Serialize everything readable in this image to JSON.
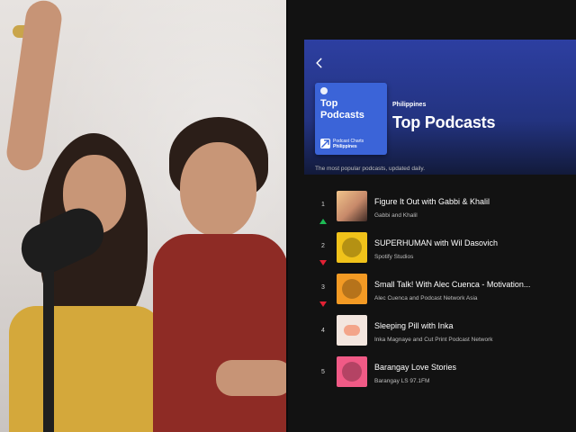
{
  "header": {
    "region": "Philippines",
    "title": "Top Podcasts",
    "cover": {
      "title_line1": "Top",
      "title_line2": "Podcasts",
      "subtitle_line1": "Podcast Charts",
      "subtitle_line2": "Philippines"
    }
  },
  "description": "The most popular podcasts, updated daily.",
  "list": [
    {
      "rank": "1",
      "title": "Figure It Out with Gabbi & Khalil",
      "author": "Gabbi and Khalil",
      "trend": "up"
    },
    {
      "rank": "2",
      "title": "SUPERHUMAN with Wil Dasovich",
      "author": "Spotify Studios",
      "trend": "down"
    },
    {
      "rank": "3",
      "title": "Small Talk! With Alec Cuenca - Motivation...",
      "author": "Alec Cuenca and Podcast Network Asia",
      "trend": "down"
    },
    {
      "rank": "4",
      "title": "Sleeping Pill with Inka",
      "author": "Inka Magnaye and Cut Print Podcast Network",
      "trend": "none"
    },
    {
      "rank": "5",
      "title": "Barangay Love Stories",
      "author": "Barangay LS 97.1FM",
      "trend": "none"
    }
  ],
  "icons": {
    "back": "chevron-left-icon",
    "trend_up": "arrow-up-icon",
    "trend_down": "arrow-down-icon"
  },
  "colors": {
    "background": "#121212",
    "header_blue": "#2d3fa1",
    "cover_blue": "#3b64d8",
    "trend_up": "#1db954",
    "trend_down": "#e22134"
  }
}
